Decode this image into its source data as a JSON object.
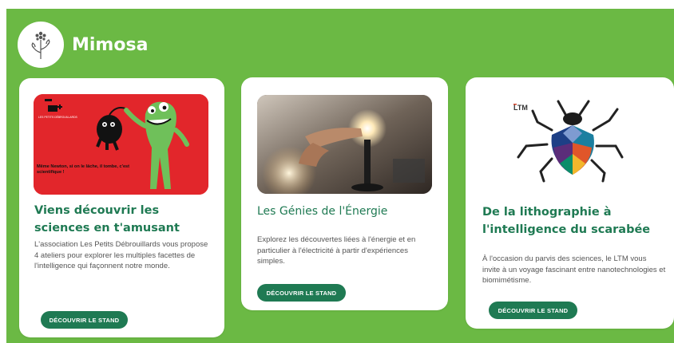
{
  "header": {
    "brand": "Mimosa",
    "logo_icon": "mimosa-flower-icon"
  },
  "colors": {
    "background": "#6bb944",
    "accent": "#1f7a53",
    "card": "#ffffff"
  },
  "cards": [
    {
      "title": "Viens découvrir les sciences en t'amusant",
      "description": "L'association Les Petits Débrouillards vous propose 4 ateliers pour explorer les multiples facettes de l'intelligence qui façonnent notre monde.",
      "button": "Découvrir le stand",
      "image": {
        "icon": "monster-illustration",
        "caption": "Même Newton, si on le lâche, il tombe, c'est scientifique !",
        "badge": "LES PETITS DÉBROUILLARDS"
      }
    },
    {
      "title": "Les Génies de l'Énergie",
      "description": "Explorez les découvertes liées à l'énergie et en particulier à l'électricité à partir d'expériences simples.",
      "button": "Découvrir le stand",
      "image": {
        "icon": "lightbulb-photo"
      }
    },
    {
      "title": "De la lithographie à l'intelligence du scarabée",
      "description": "À l'occasion du parvis des sciences, le LTM vous invite à un voyage fascinant entre nanotechnologies et biomimétisme.",
      "button": "Découvrir le stand",
      "image": {
        "icon": "beetle-illustration",
        "logo": "LTM"
      }
    }
  ]
}
